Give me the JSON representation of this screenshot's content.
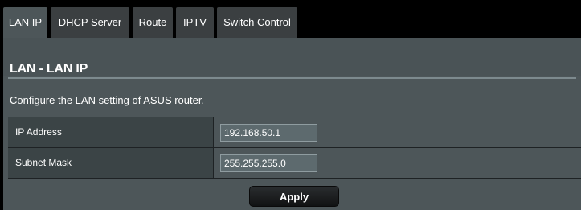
{
  "tabs": [
    {
      "label": "LAN IP",
      "active": true
    },
    {
      "label": "DHCP Server",
      "active": false
    },
    {
      "label": "Route",
      "active": false
    },
    {
      "label": "IPTV",
      "active": false
    },
    {
      "label": "Switch Control",
      "active": false
    }
  ],
  "page_title": "LAN - LAN IP",
  "description": "Configure the LAN setting of ASUS router.",
  "fields": [
    {
      "label": "IP Address",
      "value": "192.168.50.1"
    },
    {
      "label": "Subnet Mask",
      "value": "255.255.255.0"
    }
  ],
  "apply_label": "Apply",
  "colors": {
    "background": "#4d5659",
    "tab_inactive": "#3b3f41",
    "label_cell": "#3b4446",
    "input_bg": "#5d6a6e",
    "text": "#ffffff"
  }
}
